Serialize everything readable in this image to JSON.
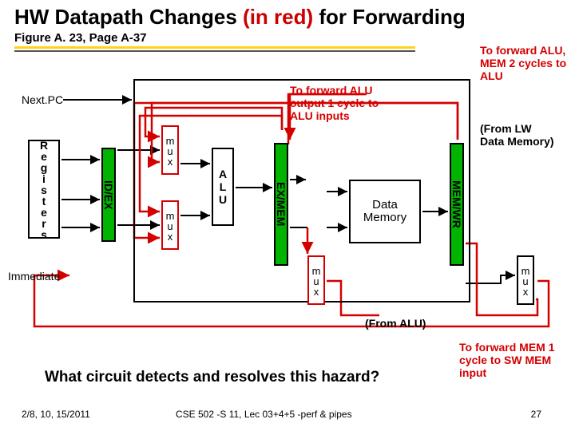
{
  "title_a": "HW Datapath Changes ",
  "title_b": "(in red)",
  "title_c": " for Forwarding",
  "subtitle": "Figure A. 23, Page A-37",
  "nextpc": "Next.PC",
  "immediate": "Immediate",
  "registers": "Registers",
  "idex": "ID/EX",
  "exmem": "EX/MEM",
  "memwr": "MEM/WR",
  "alu": "ALU",
  "mux": "mux",
  "dmem": "Data\nMemory",
  "annot1": "To forward ALU output 1 cycle to ALU inputs",
  "annot2": "To forward ALU, MEM 2 cycles to ALU",
  "annot3": "(From LW Data Memory)",
  "from_alu": "(From ALU)",
  "annot4": "To forward MEM 1 cycle to SW MEM input",
  "question": "What circuit detects and resolves this hazard?",
  "footer_left": "2/8, 10, 15/2011",
  "footer_mid": "CSE 502 -S 11, Lec 03+4+5 -perf & pipes",
  "footer_right": "27"
}
